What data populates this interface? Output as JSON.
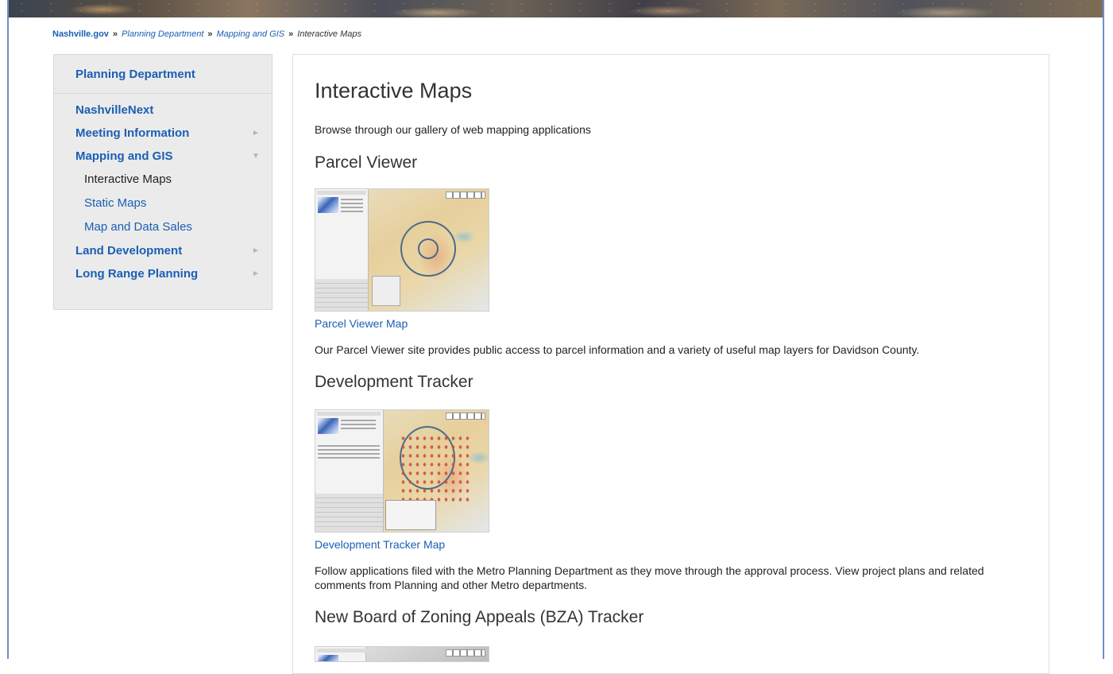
{
  "breadcrumb": {
    "home": "Nashville.gov",
    "separator": "»",
    "items": [
      "Planning Department",
      "Mapping and GIS"
    ],
    "current": "Interactive Maps"
  },
  "sidebar": {
    "heading": "Planning Department",
    "items": [
      {
        "label": "NashvilleNext",
        "arrow": ""
      },
      {
        "label": "Meeting Information",
        "arrow": "►"
      },
      {
        "label": "Mapping and GIS",
        "arrow": "▼"
      }
    ],
    "subitems": [
      {
        "label": "Interactive Maps",
        "active": true
      },
      {
        "label": "Static Maps",
        "active": false
      },
      {
        "label": "Map and Data Sales",
        "active": false
      }
    ],
    "items_after": [
      {
        "label": "Land Development",
        "arrow": "►"
      },
      {
        "label": "Long Range Planning",
        "arrow": "►"
      }
    ]
  },
  "main": {
    "title": "Interactive Maps",
    "intro": "Browse through our gallery of web mapping applications",
    "sections": [
      {
        "title": "Parcel Viewer",
        "link": "Parcel Viewer Map",
        "description": "Our Parcel Viewer site provides public access to parcel information and a variety of useful map layers for Davidson County."
      },
      {
        "title": "Development Tracker",
        "link": "Development Tracker Map",
        "description": "Follow applications filed with the Metro Planning Department as they move through the approval process. View project plans and related comments from Planning and other Metro departments."
      },
      {
        "title": "New Board of Zoning Appeals (BZA) Tracker"
      }
    ]
  },
  "colors": {
    "link": "#1a5fb4",
    "sidebar_bg": "#ebebeb",
    "frame": "#6e8fc9"
  }
}
